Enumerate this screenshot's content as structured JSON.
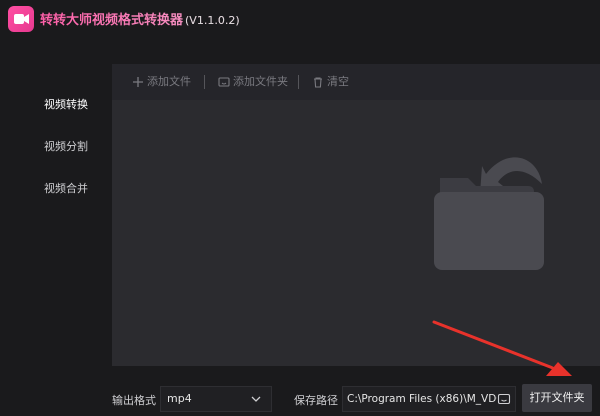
{
  "app": {
    "title": "转转大师视频格式转换器",
    "version": "(V1.1.0.2)"
  },
  "sidebar": {
    "items": [
      {
        "label": "视频转换",
        "active": true
      },
      {
        "label": "视频分割",
        "active": false
      },
      {
        "label": "视频合并",
        "active": false
      }
    ]
  },
  "toolbar": {
    "add_file": "添加文件",
    "add_folder": "添加文件夹",
    "clear": "清空"
  },
  "bottom": {
    "output_format_label": "输出格式",
    "output_format_value": "mp4",
    "save_path_label": "保存路径",
    "save_path_value": "C:\\Program Files (x86)\\M_VDC",
    "open_folder_button": "打开文件夹"
  },
  "colors": {
    "brand": "#ff4fa3",
    "annotation_arrow": "#e8322b"
  }
}
